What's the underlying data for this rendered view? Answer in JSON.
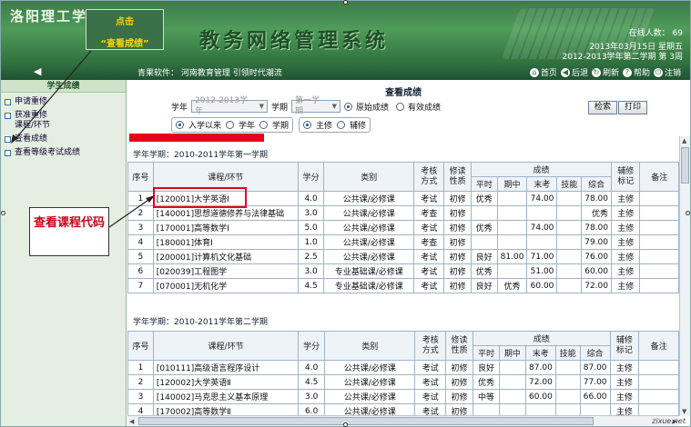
{
  "header": {
    "school": "洛阳理工学院",
    "title": "教务网络管理系统",
    "online_label": "在线人数： 69",
    "date": "2013年03月15日 星期五",
    "term": "2012-2013学年第二学期 第 3周"
  },
  "navbar": {
    "software_info": "青果软件： 河南教育管理  引领时代潮流",
    "links": [
      "首页",
      "后退",
      "刷新",
      "帮助",
      "注销"
    ]
  },
  "sidebar": {
    "heading": "学生成绩",
    "items": [
      "申请重修",
      "获准重修课程/环节",
      "查看成绩",
      "查看等级考试成绩"
    ]
  },
  "main": {
    "title": "查看成绩",
    "year_label": "学年",
    "year_value": "2012-2013学年",
    "term_label": "学期",
    "term_value": "第一学期",
    "grade_options": [
      "原始成绩",
      "有效成绩"
    ],
    "range_options": [
      "入学以来",
      "学年",
      "学期"
    ],
    "major_options": [
      "主修",
      "辅修"
    ],
    "search_button": "检索",
    "print_button": "打印"
  },
  "table_headers": {
    "seq": "序号",
    "course": "课程/环节",
    "credit": "学分",
    "category": "类别",
    "exam_mode": "考核方式",
    "study_type": "修读性质",
    "grade_group": "成绩",
    "usual": "平时",
    "midterm": "期中",
    "final": "末考",
    "skill": "技能",
    "total": "综合",
    "minor_mark": "辅修标记",
    "remarks": "备注"
  },
  "term1": {
    "label": "学年学期：2010-2011学年第一学期",
    "rows": [
      {
        "seq": "1",
        "course": "[120001]大学英语Ⅰ",
        "credit": "4.0",
        "category": "公共课/必修课",
        "mode": "考试",
        "type": "初修",
        "usual": "优秀",
        "mid": "",
        "final": "74.00",
        "skill": "",
        "total": "78.00",
        "mark": "主修"
      },
      {
        "seq": "2",
        "course": "[140001]思想道德修养与法律基础",
        "credit": "3.0",
        "category": "公共课/必修课",
        "mode": "考查",
        "type": "初修",
        "usual": "",
        "mid": "",
        "final": "",
        "skill": "",
        "total": "优秀",
        "mark": "主修"
      },
      {
        "seq": "3",
        "course": "[170001]高等数学Ⅰ",
        "credit": "5.0",
        "category": "公共课/必修课",
        "mode": "考试",
        "type": "初修",
        "usual": "优秀",
        "mid": "",
        "final": "74.00",
        "skill": "",
        "total": "78.00",
        "mark": "主修"
      },
      {
        "seq": "4",
        "course": "[180001]体育Ⅰ",
        "credit": "1.0",
        "category": "公共课/必修课",
        "mode": "考查",
        "type": "初修",
        "usual": "",
        "mid": "",
        "final": "",
        "skill": "",
        "total": "79.00",
        "mark": "主修"
      },
      {
        "seq": "5",
        "course": "[200001]计算机文化基础",
        "credit": "2.5",
        "category": "公共课/必修课",
        "mode": "考试",
        "type": "初修",
        "usual": "良好",
        "mid": "81.00",
        "final": "71.00",
        "skill": "",
        "total": "76.00",
        "mark": "主修"
      },
      {
        "seq": "6",
        "course": "[020039]工程图学",
        "credit": "3.0",
        "category": "专业基础课/必修课",
        "mode": "考试",
        "type": "初修",
        "usual": "优秀",
        "mid": "",
        "final": "51.00",
        "skill": "",
        "total": "60.00",
        "mark": "主修"
      },
      {
        "seq": "7",
        "course": "[070001]无机化学",
        "credit": "4.5",
        "category": "专业基础课/必修课",
        "mode": "考试",
        "type": "初修",
        "usual": "良好",
        "mid": "优秀",
        "final": "60.00",
        "skill": "",
        "total": "72.00",
        "mark": "主修"
      }
    ]
  },
  "term2": {
    "label": "学年学期：2010-2011学年第二学期",
    "rows": [
      {
        "seq": "1",
        "course": "[010111]高级语言程序设计",
        "credit": "4.0",
        "category": "公共课/必修课",
        "mode": "考试",
        "type": "初修",
        "usual": "良好",
        "mid": "",
        "final": "87.00",
        "skill": "",
        "total": "87.00",
        "mark": "主修"
      },
      {
        "seq": "2",
        "course": "[120002]大学英语Ⅱ",
        "credit": "4.5",
        "category": "公共课/必修课",
        "mode": "考试",
        "type": "初修",
        "usual": "优秀",
        "mid": "",
        "final": "72.00",
        "skill": "",
        "total": "77.00",
        "mark": "主修"
      },
      {
        "seq": "3",
        "course": "[140002]马克思主义基本原理",
        "credit": "3.0",
        "category": "公共课/必修课",
        "mode": "考试",
        "type": "初修",
        "usual": "中等",
        "mid": "",
        "final": "60.00",
        "skill": "",
        "total": "66.00",
        "mark": "主修"
      },
      {
        "seq": "4",
        "course": "[170002]高等数学Ⅱ",
        "credit": "6.0",
        "category": "公共课/必修课",
        "mode": "考试",
        "type": "初修",
        "usual": "",
        "mid": "",
        "final": "",
        "skill": "",
        "total": "",
        "mark": "主修"
      }
    ]
  },
  "annotations": {
    "callout1_line1": "点击",
    "callout1_line2": "“查看成绩”",
    "callout2": "查看课程代码"
  },
  "watermark": "zixue.net"
}
